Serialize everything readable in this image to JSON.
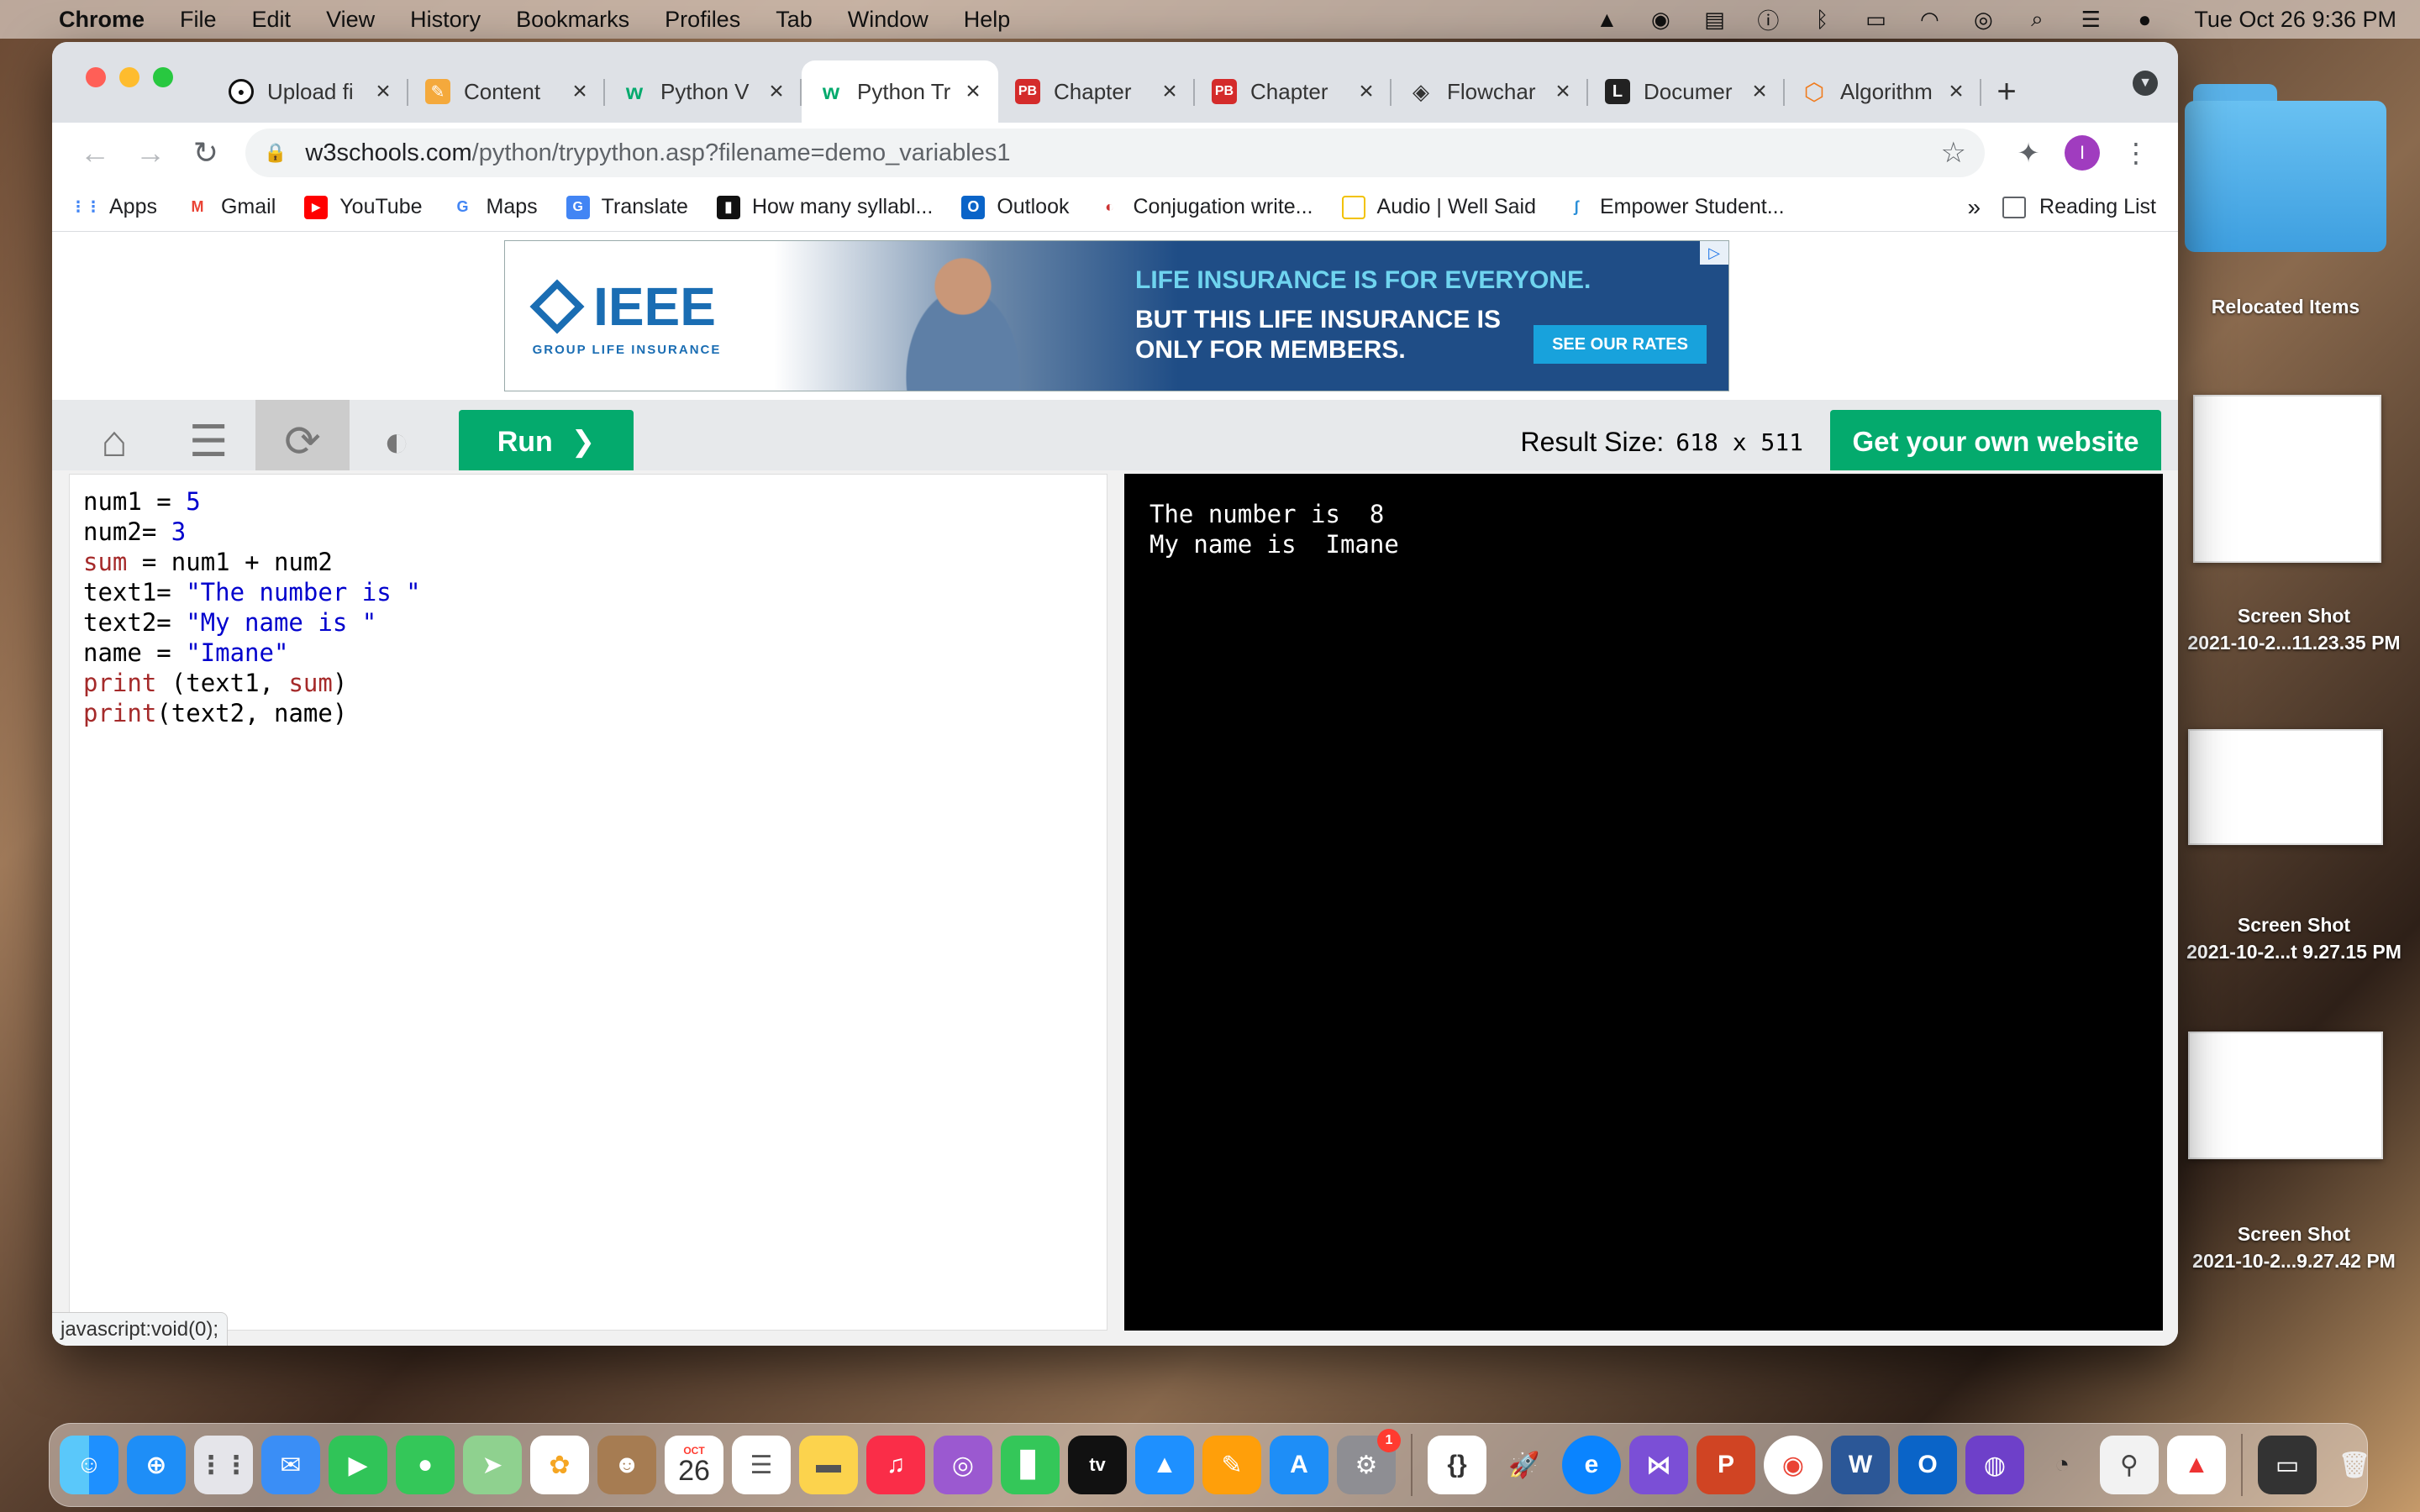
{
  "menubar": {
    "app": "Chrome",
    "items": [
      "File",
      "Edit",
      "View",
      "History",
      "Bookmarks",
      "Profiles",
      "Tab",
      "Window",
      "Help"
    ],
    "clock": "Tue Oct 26  9:36 PM"
  },
  "tabs": [
    {
      "title": "Upload fi",
      "icon": "github-icon"
    },
    {
      "title": "Content",
      "icon": "content-icon"
    },
    {
      "title": "Python V",
      "icon": "w3schools-icon"
    },
    {
      "title": "Python Tr",
      "icon": "w3schools-icon",
      "active": true
    },
    {
      "title": "Chapter",
      "icon": "pb-icon"
    },
    {
      "title": "Chapter",
      "icon": "pb-icon"
    },
    {
      "title": "Flowchar",
      "icon": "flowchart-icon"
    },
    {
      "title": "Documer",
      "icon": "document-icon"
    },
    {
      "title": "Algorithm",
      "icon": "algorithm-icon"
    }
  ],
  "omnibox": {
    "host": "w3schools.com",
    "path": "/python/trypython.asp?filename=demo_variables1"
  },
  "profile_initial": "I",
  "bookmarks": [
    {
      "label": "Apps"
    },
    {
      "label": "Gmail"
    },
    {
      "label": "YouTube"
    },
    {
      "label": "Maps"
    },
    {
      "label": "Translate"
    },
    {
      "label": "How many syllabl..."
    },
    {
      "label": "Outlook"
    },
    {
      "label": "Conjugation write..."
    },
    {
      "label": "Audio | Well Said"
    },
    {
      "label": "Empower Student..."
    }
  ],
  "bookmarks_more": "»",
  "reading_list": "Reading List",
  "ad": {
    "brand": "IEEE",
    "brand_sub": "GROUP LIFE INSURANCE",
    "line1": "LIFE INSURANCE IS FOR EVERYONE.",
    "line2": "BUT THIS LIFE INSURANCE IS",
    "line3": "ONLY FOR MEMBERS.",
    "cta": "SEE OUR RATES"
  },
  "w3": {
    "run_label": "Run",
    "result_size_label": "Result Size:",
    "result_size_value": "618 x 511",
    "get_website": "Get your own website"
  },
  "output": {
    "line1": "The number is  8",
    "line2": "My name is  Imane"
  },
  "statusbar": "javascript:void(0);",
  "desktop": {
    "folder_label": "Relocated Items",
    "shot1_label_a": "Screen Shot",
    "shot1_label_b": "2021-10-2...11.23.35 PM",
    "shot2_label_a": "Screen Shot",
    "shot2_label_b": "2021-10-2...t 9.27.15 PM",
    "shot3_label_a": "Screen Shot",
    "shot3_label_b": "2021-10-2...9.27.42 PM"
  },
  "dock": {
    "calendar_month": "OCT",
    "calendar_day": "26",
    "settings_badge": "1"
  }
}
